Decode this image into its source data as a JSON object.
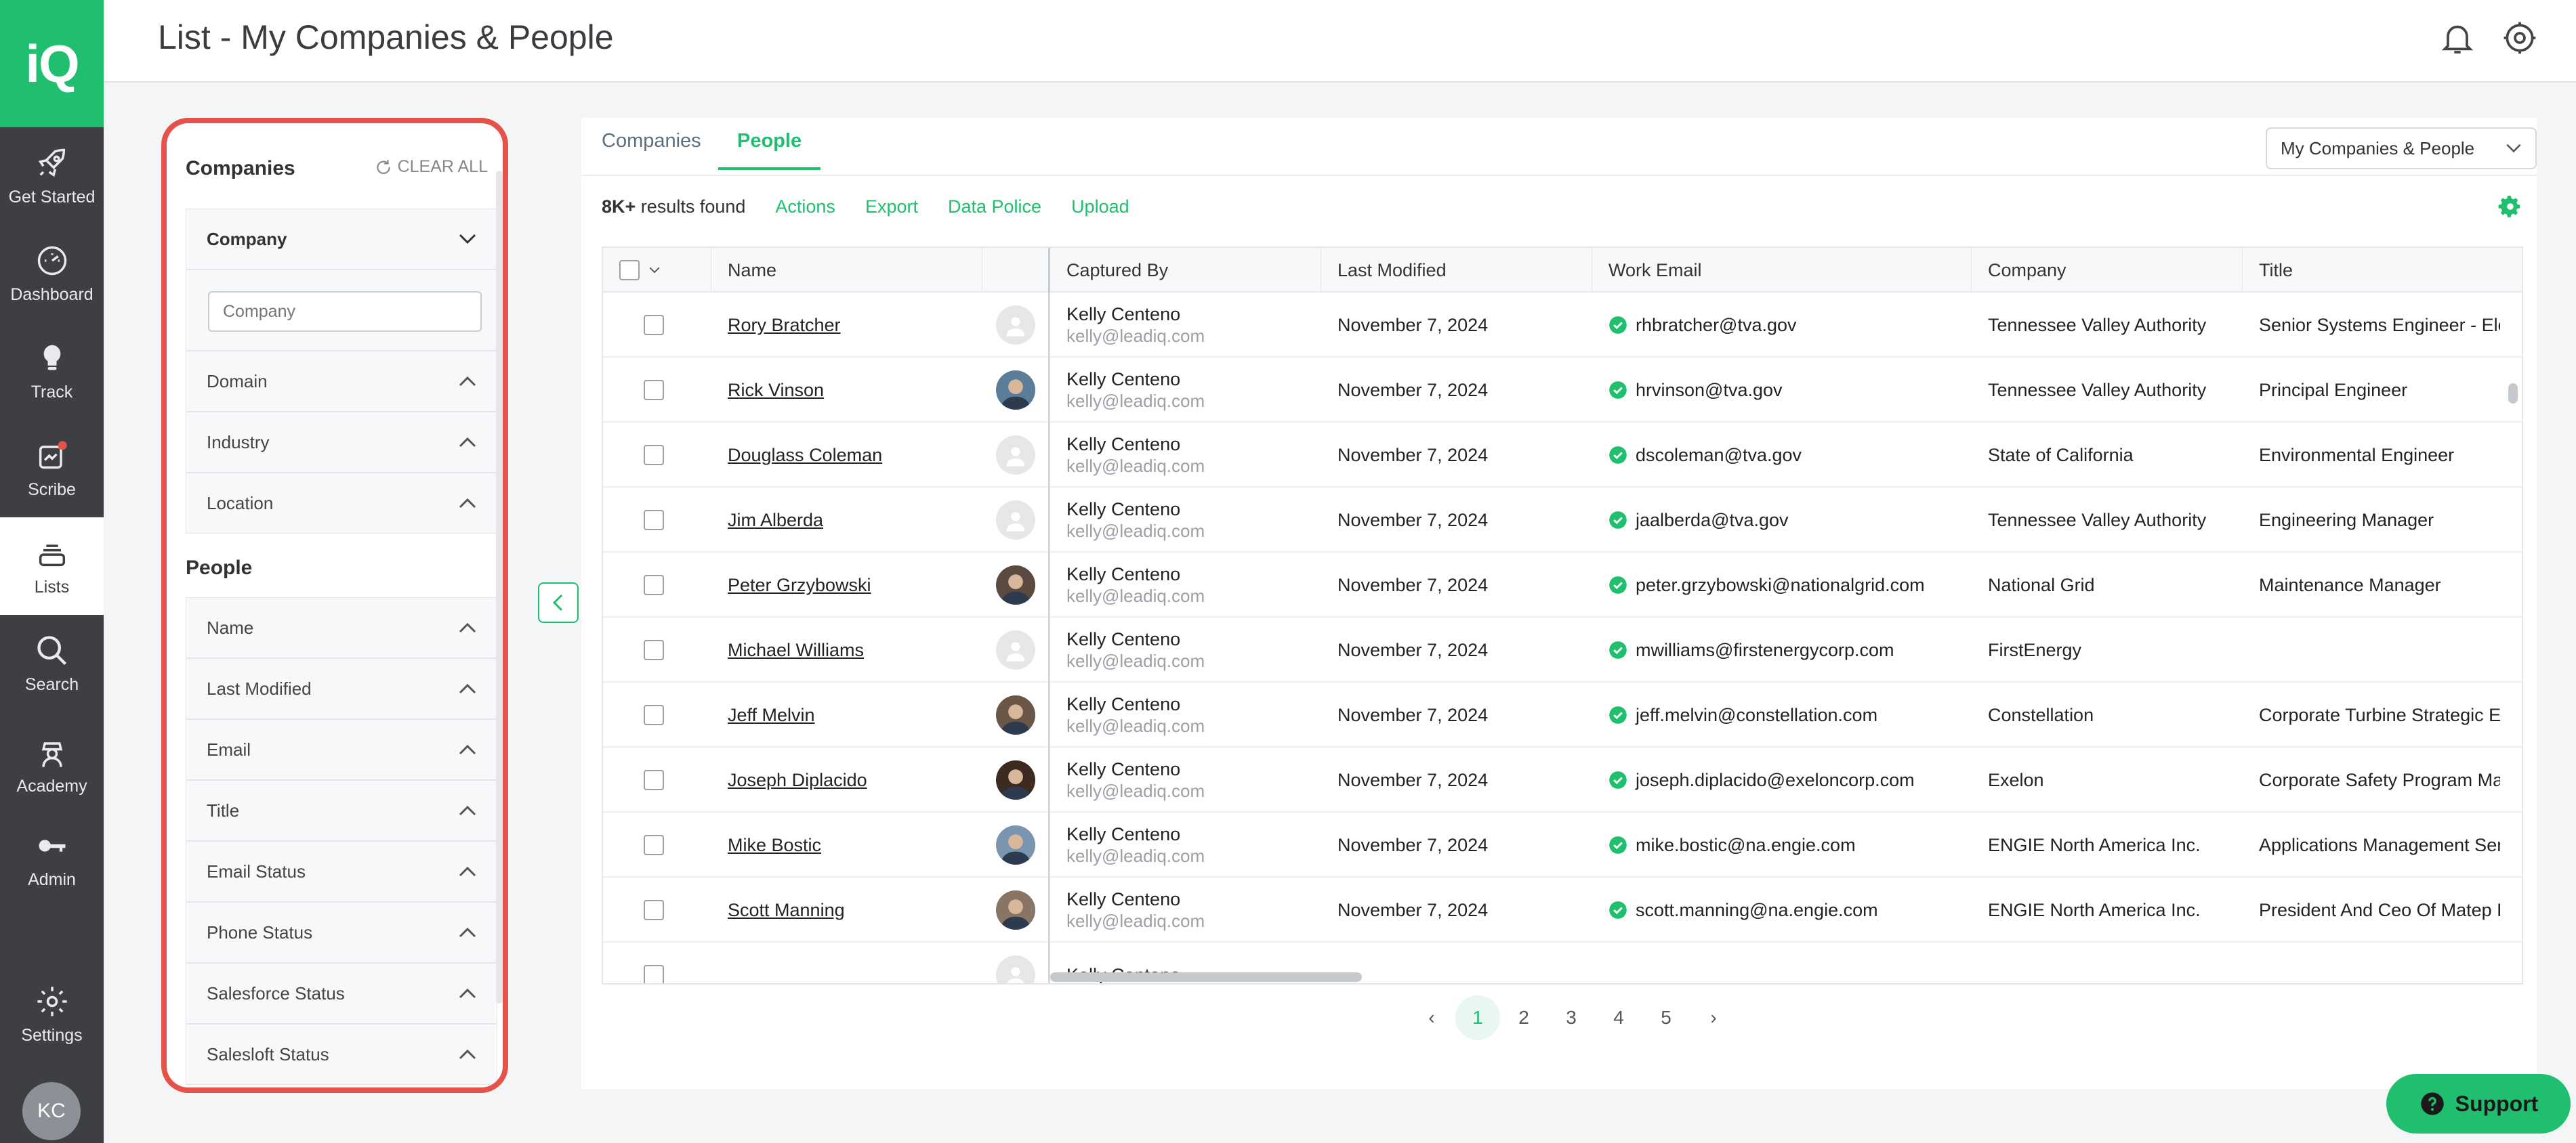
{
  "app": {
    "logo_text": "iQ",
    "accent": "#1fbf6f"
  },
  "header": {
    "title": "List - My Companies & People"
  },
  "nav": {
    "items": [
      {
        "label": "Get Started",
        "icon": "rocket-icon"
      },
      {
        "label": "Dashboard",
        "icon": "speedometer-icon"
      },
      {
        "label": "Track",
        "icon": "lightbulb-icon"
      },
      {
        "label": "Scribe",
        "icon": "scribe-icon"
      },
      {
        "label": "Lists",
        "icon": "stack-icon"
      },
      {
        "label": "Search",
        "icon": "search-icon"
      },
      {
        "label": "Academy",
        "icon": "academy-icon"
      },
      {
        "label": "Admin",
        "icon": "key-icon"
      },
      {
        "label": "Settings",
        "icon": "gear-icon"
      }
    ],
    "active": "Lists",
    "user_initials": "KC"
  },
  "filters": {
    "companies_heading": "Companies",
    "clear_all": "CLEAR ALL",
    "company_label": "Company",
    "company_placeholder": "Company",
    "company_filters": [
      "Domain",
      "Industry",
      "Location"
    ],
    "people_heading": "People",
    "people_filters": [
      "Name",
      "Last Modified",
      "Email",
      "Title",
      "Email Status",
      "Phone Status",
      "Salesforce Status",
      "Salesloft Status"
    ]
  },
  "tabs": [
    "Companies",
    "People"
  ],
  "active_tab": "People",
  "list_selector": "My Companies & People",
  "toolbar": {
    "count": "8K+",
    "count_suffix": " results found",
    "actions": [
      "Actions",
      "Export",
      "Data Police",
      "Upload"
    ]
  },
  "table": {
    "columns": [
      "Name",
      "Captured By",
      "Last Modified",
      "Work Email",
      "Company",
      "Title"
    ],
    "rows": [
      {
        "name": "Rory Bratcher",
        "captured_by": "Kelly Centeno",
        "captured_email": "kelly@leadiq.com",
        "modified": "November 7, 2024",
        "email": "rhbratcher@tva.gov",
        "company": "Tennessee Valley Authority",
        "title": "Senior Systems Engineer - Elect"
      },
      {
        "name": "Rick Vinson",
        "captured_by": "Kelly Centeno",
        "captured_email": "kelly@leadiq.com",
        "modified": "November 7, 2024",
        "email": "hrvinson@tva.gov",
        "company": "Tennessee Valley Authority",
        "title": "Principal Engineer"
      },
      {
        "name": "Douglass Coleman",
        "captured_by": "Kelly Centeno",
        "captured_email": "kelly@leadiq.com",
        "modified": "November 7, 2024",
        "email": "dscoleman@tva.gov",
        "company": "State of California",
        "title": "Environmental Engineer"
      },
      {
        "name": "Jim Alberda",
        "captured_by": "Kelly Centeno",
        "captured_email": "kelly@leadiq.com",
        "modified": "November 7, 2024",
        "email": "jaalberda@tva.gov",
        "company": "Tennessee Valley Authority",
        "title": "Engineering Manager"
      },
      {
        "name": "Peter Grzybowski",
        "captured_by": "Kelly Centeno",
        "captured_email": "kelly@leadiq.com",
        "modified": "November 7, 2024",
        "email": "peter.grzybowski@nationalgrid.com",
        "company": "National Grid",
        "title": "Maintenance Manager"
      },
      {
        "name": "Michael Williams",
        "captured_by": "Kelly Centeno",
        "captured_email": "kelly@leadiq.com",
        "modified": "November 7, 2024",
        "email": "mwilliams@firstenergycorp.com",
        "company": "FirstEnergy",
        "title": ""
      },
      {
        "name": "Jeff Melvin",
        "captured_by": "Kelly Centeno",
        "captured_email": "kelly@leadiq.com",
        "modified": "November 7, 2024",
        "email": "jeff.melvin@constellation.com",
        "company": "Constellation",
        "title": "Corporate Turbine Strategic Eng"
      },
      {
        "name": "Joseph Diplacido",
        "captured_by": "Kelly Centeno",
        "captured_email": "kelly@leadiq.com",
        "modified": "November 7, 2024",
        "email": "joseph.diplacido@exeloncorp.com",
        "company": "Exelon",
        "title": "Corporate Safety Program Mana"
      },
      {
        "name": "Mike Bostic",
        "captured_by": "Kelly Centeno",
        "captured_email": "kelly@leadiq.com",
        "modified": "November 7, 2024",
        "email": "mike.bostic@na.engie.com",
        "company": "ENGIE North America Inc.",
        "title": "Applications Management Seni"
      },
      {
        "name": "Scott Manning",
        "captured_by": "Kelly Centeno",
        "captured_email": "kelly@leadiq.com",
        "modified": "November 7, 2024",
        "email": "scott.manning@na.engie.com",
        "company": "ENGIE North America Inc.",
        "title": "President And Ceo Of Matep Llc"
      },
      {
        "name": "",
        "captured_by": "Kelly Centeno",
        "captured_email": "",
        "modified": "",
        "email": "",
        "company": "",
        "title": ""
      }
    ]
  },
  "pagination": {
    "pages": [
      "1",
      "2",
      "3",
      "4",
      "5"
    ],
    "current": "1",
    "prev": "‹",
    "next": "›"
  },
  "support": {
    "label": "Support"
  }
}
